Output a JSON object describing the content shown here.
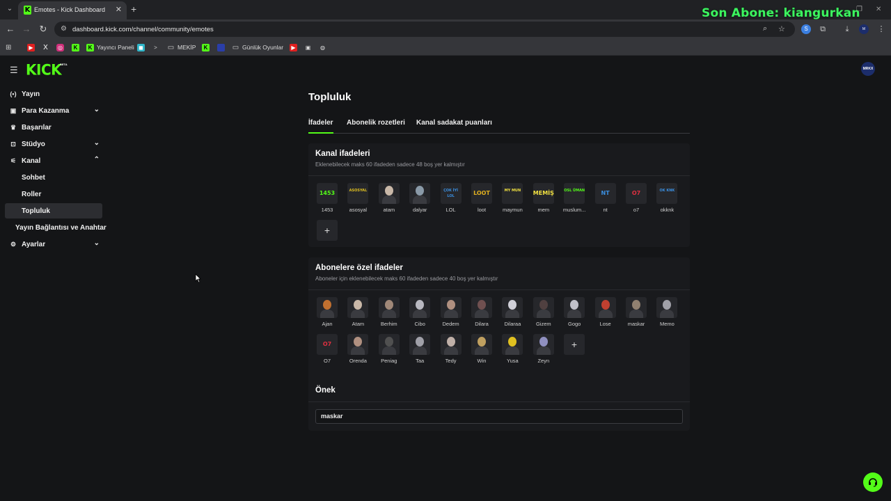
{
  "browser": {
    "tab_title": "Emotes - Kick Dashboard",
    "url": "dashboard.kick.com/channel/community/emotes",
    "overlay_text": "Son Abone: kiangurkan",
    "bookmarks": [
      {
        "label": "",
        "icon": "youtube-icon"
      },
      {
        "label": "",
        "icon": "x-icon"
      },
      {
        "label": "",
        "icon": "instagram-icon"
      },
      {
        "label": "",
        "icon": "kick-icon"
      },
      {
        "label": "Yayıncı Paneli",
        "icon": "kick-icon"
      },
      {
        "label": "",
        "icon": "app-icon"
      },
      {
        "label": "",
        "icon": "terminal-icon"
      },
      {
        "label": "MEKİP",
        "icon": "folder-icon"
      },
      {
        "label": "",
        "icon": "kick-icon"
      },
      {
        "label": "",
        "icon": "blue-app-icon"
      },
      {
        "label": "Günlük Oyunlar",
        "icon": "folder-icon"
      },
      {
        "label": "",
        "icon": "youtube-icon"
      },
      {
        "label": "",
        "icon": "image-icon"
      },
      {
        "label": "",
        "icon": "globe-icon"
      }
    ]
  },
  "app": {
    "logo": "KICK",
    "logo_badge": "BETA",
    "avatar_text": "MRKX"
  },
  "sidebar": {
    "items": [
      {
        "label": "Yayın",
        "icon": "broadcast-icon",
        "chevron": ""
      },
      {
        "label": "Para Kazanma",
        "icon": "money-icon",
        "chevron": "down"
      },
      {
        "label": "Başarılar",
        "icon": "trophy-icon",
        "chevron": ""
      },
      {
        "label": "Stüdyo",
        "icon": "studio-icon",
        "chevron": "down"
      },
      {
        "label": "Kanal",
        "icon": "channel-icon",
        "chevron": "up"
      },
      {
        "label": "Sohbet",
        "icon": "",
        "chevron": ""
      },
      {
        "label": "Roller",
        "icon": "",
        "chevron": ""
      },
      {
        "label": "Topluluk",
        "icon": "",
        "chevron": ""
      },
      {
        "label": "Yayın Bağlantısı ve Anahtar",
        "icon": "",
        "chevron": ""
      },
      {
        "label": "Ayarlar",
        "icon": "gear-icon",
        "chevron": "down"
      }
    ]
  },
  "page": {
    "title": "Topluluk",
    "tabs": [
      "İfadeler",
      "Abonelik rozetleri",
      "Kanal sadakat puanları"
    ],
    "active_tab": "İfadeler"
  },
  "channel_emotes": {
    "title": "Kanal ifadeleri",
    "subtitle": "Eklenebilecek maks 60 ifadeden sadece 48 boş yer kalmıştır",
    "emotes": [
      {
        "name": "1453",
        "art": "1453",
        "color": "#53fc18"
      },
      {
        "name": "asosyal",
        "art": "ASOSYAL",
        "color": "#e0c020"
      },
      {
        "name": "atam",
        "art": "",
        "color": "#c9b8a8"
      },
      {
        "name": "dalyar",
        "art": "",
        "color": "#8a9aa8"
      },
      {
        "name": "LOL",
        "art": "ÇOK İYİ LOL",
        "color": "#3b8fe0"
      },
      {
        "name": "loot",
        "art": "LOOT",
        "color": "#e0b020"
      },
      {
        "name": "maymun",
        "art": "MY MUN",
        "color": "#f0e040"
      },
      {
        "name": "mem",
        "art": "MEMİŞ",
        "color": "#f0e040"
      },
      {
        "name": "muslum...",
        "art": "OSL ÜMAN",
        "color": "#53fc18"
      },
      {
        "name": "nt",
        "art": "NT",
        "color": "#3b8fe0"
      },
      {
        "name": "o7",
        "art": "O7",
        "color": "#e03040"
      },
      {
        "name": "okknk",
        "art": "OK KNK",
        "color": "#3b8fe0"
      }
    ]
  },
  "sub_emotes": {
    "title": "Abonelere özel ifadeler",
    "subtitle": "Aboneler için eklenebilecek maks 60 ifadeden sadece 40 boş yer kalmıştır",
    "emotes": [
      {
        "name": "Ajan",
        "art": "",
        "color": "#c07030"
      },
      {
        "name": "Atam",
        "art": "",
        "color": "#c9b8a8"
      },
      {
        "name": "Berhim",
        "art": "",
        "color": "#a08878"
      },
      {
        "name": "Cibo",
        "art": "",
        "color": "#b8b8c0"
      },
      {
        "name": "Dedem",
        "art": "",
        "color": "#b09080"
      },
      {
        "name": "Dilara",
        "art": "",
        "color": "#705050"
      },
      {
        "name": "Dilaraa",
        "art": "",
        "color": "#d0d0d8"
      },
      {
        "name": "Gizem",
        "art": "",
        "color": "#504040"
      },
      {
        "name": "Gogo",
        "art": "",
        "color": "#c0c0c8"
      },
      {
        "name": "Lose",
        "art": "",
        "color": "#c04030"
      },
      {
        "name": "maskar",
        "art": "",
        "color": "#908070"
      },
      {
        "name": "Memo",
        "art": "",
        "color": "#a0a0a8"
      },
      {
        "name": "O7",
        "art": "O7",
        "color": "#e03040"
      },
      {
        "name": "Orenda",
        "art": "",
        "color": "#b09080"
      },
      {
        "name": "Peniag",
        "art": "",
        "color": "#505050"
      },
      {
        "name": "Taa",
        "art": "",
        "color": "#a0a0a8"
      },
      {
        "name": "Tedy",
        "art": "",
        "color": "#c0b0a8"
      },
      {
        "name": "Win",
        "art": "",
        "color": "#c0a060"
      },
      {
        "name": "Yusa",
        "art": "",
        "color": "#e0c020"
      },
      {
        "name": "Zeyn",
        "art": "",
        "color": "#9090c0"
      }
    ]
  },
  "prefix": {
    "title": "Önek",
    "value": "maskar"
  },
  "colors": {
    "accent": "#53fc18",
    "background": "#141517",
    "card": "#191a1d"
  }
}
